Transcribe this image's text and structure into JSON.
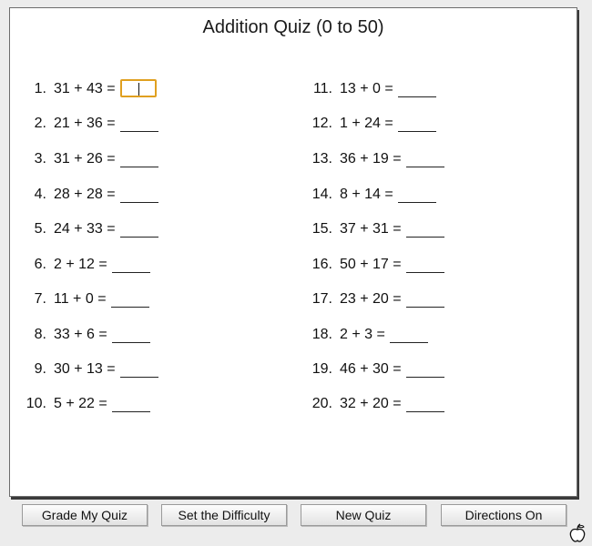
{
  "title": "Addition Quiz (0 to 50)",
  "problems": [
    {
      "num": "1.",
      "expr": "31 + 43 ="
    },
    {
      "num": "2.",
      "expr": "21 + 36 ="
    },
    {
      "num": "3.",
      "expr": "31 + 26 ="
    },
    {
      "num": "4.",
      "expr": "28 + 28 ="
    },
    {
      "num": "5.",
      "expr": "24 + 33 ="
    },
    {
      "num": "6.",
      "expr": "2 + 12 ="
    },
    {
      "num": "7.",
      "expr": "11 + 0 ="
    },
    {
      "num": "8.",
      "expr": "33 + 6 ="
    },
    {
      "num": "9.",
      "expr": "30 + 13 ="
    },
    {
      "num": "10.",
      "expr": "5 + 22 ="
    },
    {
      "num": "11.",
      "expr": "13 + 0 ="
    },
    {
      "num": "12.",
      "expr": "1 + 24 ="
    },
    {
      "num": "13.",
      "expr": "36 + 19 ="
    },
    {
      "num": "14.",
      "expr": "8 + 14 ="
    },
    {
      "num": "15.",
      "expr": "37 + 31 ="
    },
    {
      "num": "16.",
      "expr": "50 + 17 ="
    },
    {
      "num": "17.",
      "expr": "23 + 20 ="
    },
    {
      "num": "18.",
      "expr": "2 + 3 ="
    },
    {
      "num": "19.",
      "expr": "46 + 30 ="
    },
    {
      "num": "20.",
      "expr": "32 + 20 ="
    }
  ],
  "buttons": {
    "grade": "Grade My Quiz",
    "difficulty": "Set the Difficulty",
    "new_quiz": "New Quiz",
    "directions": "Directions On"
  },
  "icons": {
    "cursor": "apple-cursor-icon"
  },
  "colors": {
    "focus_border": "#e0a020",
    "panel_bg": "#ffffff",
    "page_bg": "#ececec"
  }
}
